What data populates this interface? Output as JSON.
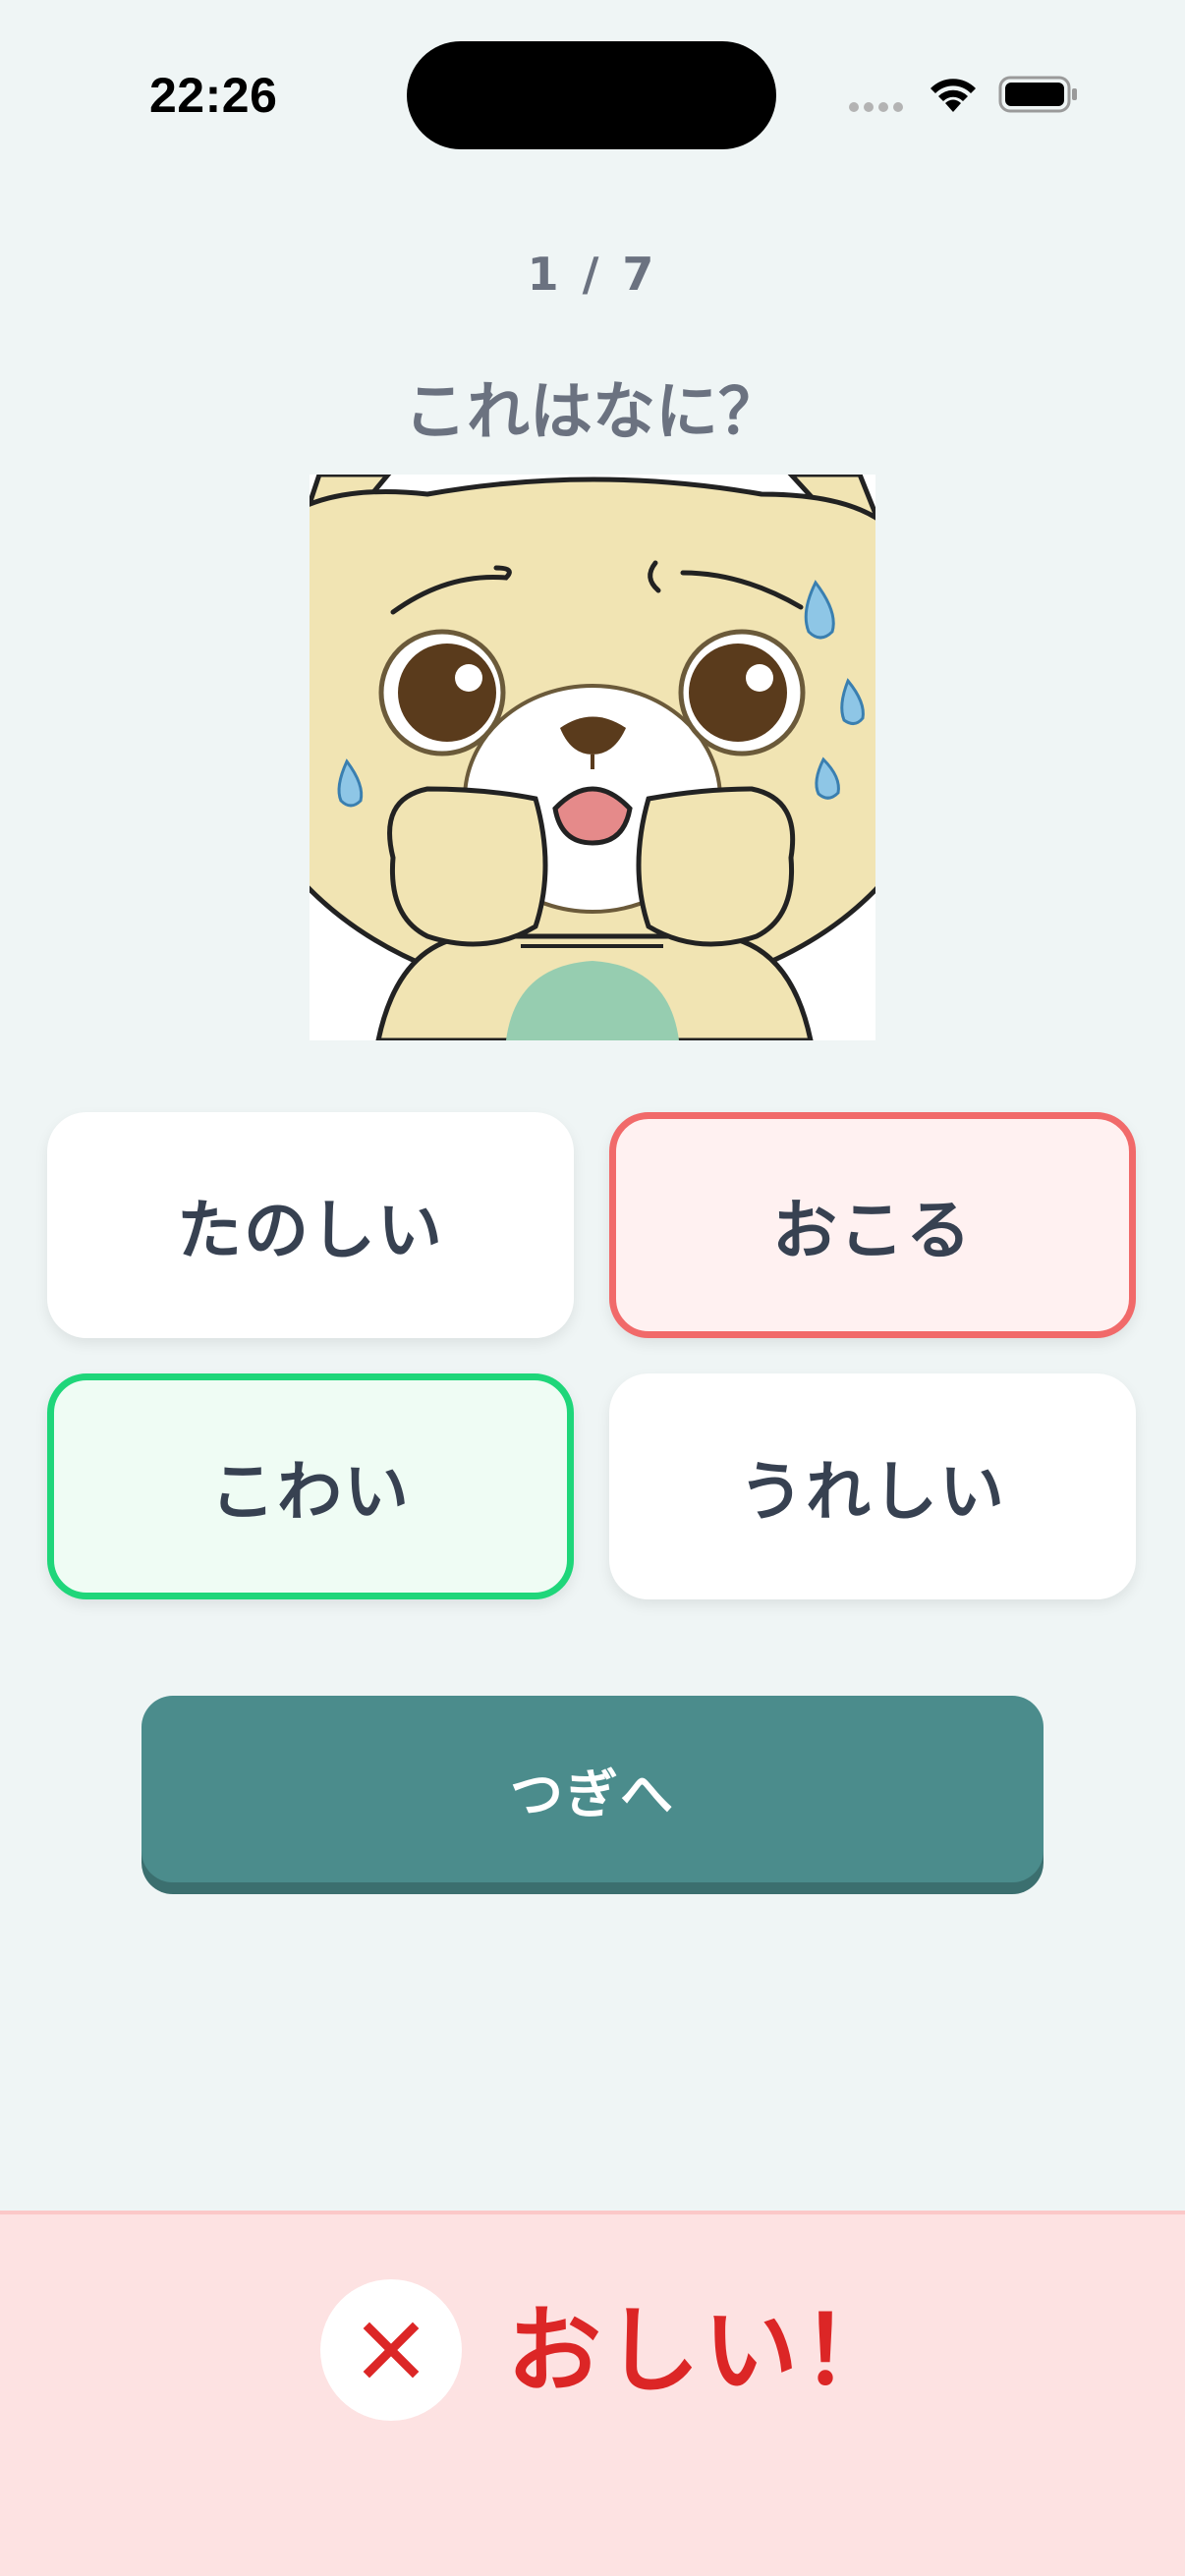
{
  "status_bar": {
    "time": "22:26",
    "icons": [
      "signal-icon",
      "wifi-icon",
      "battery-icon"
    ]
  },
  "quiz": {
    "progress": "1 / 7",
    "question": "これはなに？",
    "image_icon": "scared-bear-illustration",
    "options": [
      {
        "label": "たのしい",
        "state": "default"
      },
      {
        "label": "おこる",
        "state": "incorrect-selected"
      },
      {
        "label": "こわい",
        "state": "correct"
      },
      {
        "label": "うれしい",
        "state": "default"
      }
    ],
    "next_label": "つぎへ"
  },
  "feedback": {
    "icon": "close-icon",
    "text": "おしい！"
  },
  "colors": {
    "background": "#eff5f5",
    "accent": "#4b8c8c",
    "incorrect": "#f16a6a",
    "correct": "#1fd67a",
    "feedback_text": "#dc2626",
    "feedback_background": "#fde2e2"
  }
}
